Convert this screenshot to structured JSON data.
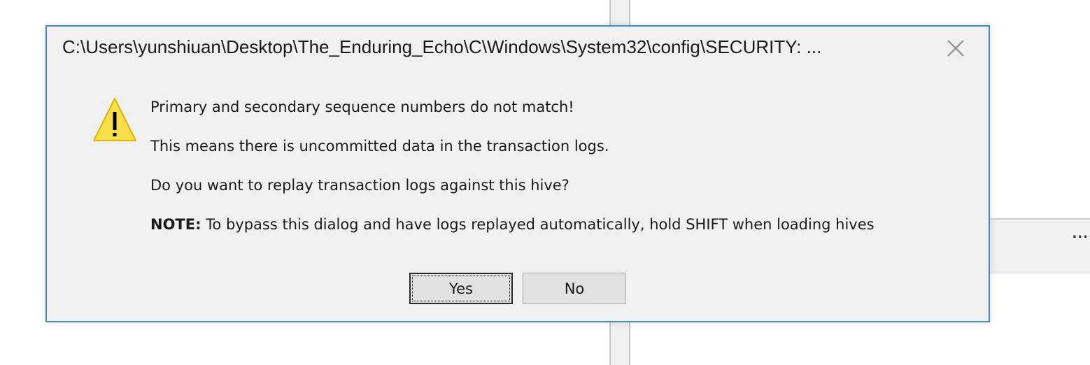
{
  "dialog": {
    "title": "C:\\Users\\yunshiuan\\Desktop\\The_Enduring_Echo\\C\\Windows\\System32\\config\\SECURITY: ...",
    "close_icon": "close-icon",
    "warning_icon": "warning-icon",
    "message_line1": "Primary and secondary sequence numbers do not match!",
    "message_line2": "This means there is uncommitted data in the transaction logs.",
    "message_line3": "Do you want to replay transaction logs against this hive?",
    "note_label": "NOTE:",
    "note_text": " To bypass this dialog and have logs replayed automatically, hold SHIFT when loading hives",
    "yes_label": "Yes",
    "no_label": "No"
  },
  "background": {
    "ellipsis": "..."
  },
  "colors": {
    "dialog_border": "#4a86c8",
    "dialog_background": "#f0f0f0",
    "warning_fill": "#f9e04b",
    "warning_stroke": "#e0b400"
  }
}
